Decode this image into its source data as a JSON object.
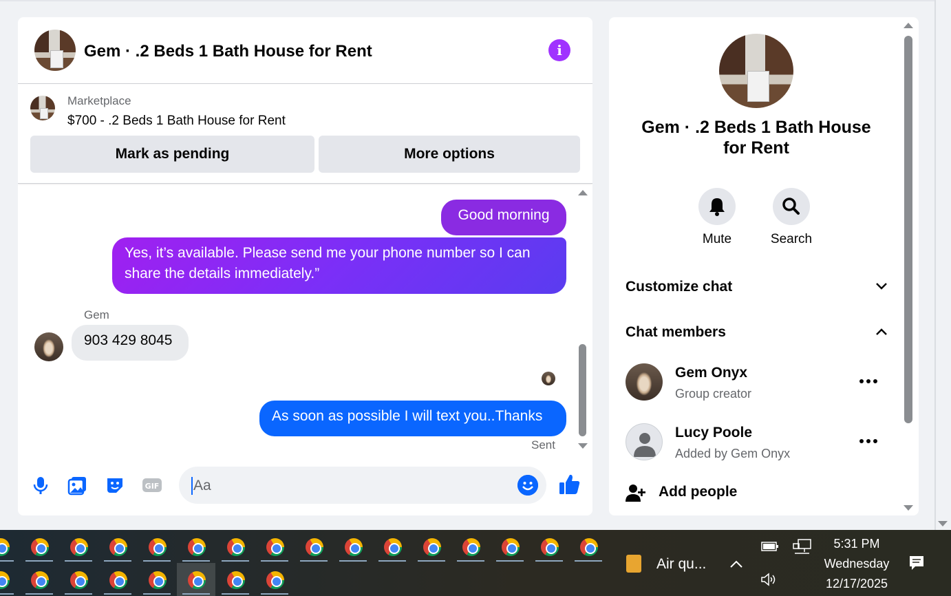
{
  "chat": {
    "header_title": "Gem · .2 Beds 1 Bath House for Rent",
    "marketplace_label": "Marketplace",
    "marketplace_item": "$700 - .2 Beds 1 Bath House for Rent",
    "mark_pending_label": "Mark as pending",
    "more_options_label": "More options",
    "messages": [
      {
        "from": "me",
        "text": "Good morning"
      },
      {
        "from": "me",
        "text": "Yes, it’s available. Please send me your phone number so I can share the details immediately.”"
      },
      {
        "from": "Gem",
        "sender_label": "Gem",
        "text": "903 429 8045"
      },
      {
        "from": "me",
        "text": "As soon as possible I will text you..Thanks",
        "status": "Sent"
      }
    ],
    "composer_placeholder": "Aa",
    "composer_icons": [
      "microphone-icon",
      "photo-icon",
      "sticker-icon",
      "gif-icon",
      "emoji-icon",
      "thumbs-up-icon"
    ]
  },
  "info_panel": {
    "title": "Gem · .2 Beds 1 Bath House for Rent",
    "actions": [
      {
        "label": "Mute",
        "icon": "bell-icon"
      },
      {
        "label": "Search",
        "icon": "magnifier-icon"
      }
    ],
    "customize_label": "Customize chat",
    "members_label": "Chat members",
    "members": [
      {
        "name": "Gem Onyx",
        "subtitle": "Group creator"
      },
      {
        "name": "Lucy Poole",
        "subtitle": "Added by Gem Onyx"
      }
    ],
    "add_people_label": "Add people"
  },
  "taskbar": {
    "weather_text": "Air qu...",
    "time": "5:31 PM",
    "day": "Wednesday",
    "date": "12/17/2025",
    "row1_app_count": 16,
    "row2_app_count": 8
  },
  "colors": {
    "messenger_purple": "#8a2be2",
    "messenger_blue": "#0a66ff",
    "info_purple": "#a033ff",
    "incoming_grey": "#e9ebee",
    "button_grey": "#e4e6eb"
  }
}
